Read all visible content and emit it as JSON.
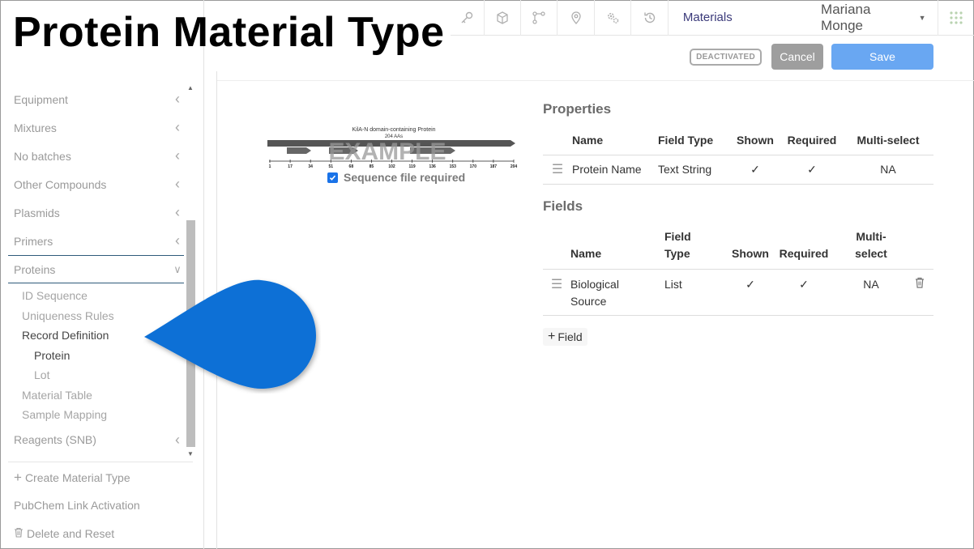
{
  "overlay": {
    "title": "Protein Material Type"
  },
  "nav": {
    "icons": [
      "key-icon",
      "cube-icon",
      "workflow-icon",
      "location-pin-icon",
      "settings-gears-icon",
      "history-icon"
    ],
    "materials_label": "Materials",
    "user_name": "Mariana Monge"
  },
  "actions": {
    "status_badge": "DEACTIVATED",
    "cancel_label": "Cancel",
    "save_label": "Save"
  },
  "sidebar": {
    "items": [
      {
        "label": "Equipment"
      },
      {
        "label": "Mixtures"
      },
      {
        "label": "No batches"
      },
      {
        "label": "Other Compounds"
      },
      {
        "label": "Plasmids"
      },
      {
        "label": "Primers"
      }
    ],
    "open_item": {
      "label": "Proteins",
      "children": [
        {
          "label": "ID Sequence"
        },
        {
          "label": "Uniqueness Rules"
        },
        {
          "label": "Record Definition"
        },
        {
          "label": "Protein"
        },
        {
          "label": "Lot"
        },
        {
          "label": "Material Table"
        },
        {
          "label": "Sample Mapping"
        }
      ]
    },
    "after_item": {
      "label": "Reagents (SNB)"
    },
    "create_label": "Create Material Type",
    "pubchem_label": "PubChem Link Activation",
    "delete_label": "Delete and Reset"
  },
  "protein_image": {
    "title": "KilA-N domain-containing Protein",
    "length_label": "204 AAs",
    "watermark": "EXAMPLE",
    "ticks": [
      "1",
      "17",
      "34",
      "51",
      "68",
      "85",
      "102",
      "119",
      "136",
      "153",
      "170",
      "187",
      "204"
    ],
    "checkbox_label": "Sequence file required",
    "checkbox_checked": true
  },
  "properties": {
    "heading": "Properties",
    "columns": [
      "Name",
      "Field Type",
      "Shown",
      "Required",
      "Multi-select"
    ],
    "rows": [
      {
        "name": "Protein Name",
        "field_type": "Text String",
        "shown": "✓",
        "required": "✓",
        "multi_select": "NA"
      }
    ]
  },
  "fields": {
    "heading": "Fields",
    "columns": {
      "name": "Name",
      "field_type_1": "Field",
      "field_type_2": "Type",
      "shown": "Shown",
      "required": "Required",
      "multi_1": "Multi-",
      "multi_2": "select"
    },
    "rows": [
      {
        "name_1": "Biological",
        "name_2": "Source",
        "field_type": "List",
        "shown": "✓",
        "required": "✓",
        "multi_select": "NA"
      }
    ],
    "add_label": "Field"
  },
  "colors": {
    "save": "#69a7f2",
    "cancel": "#9e9e9e",
    "callout": "#0a6fd6",
    "nav_text": "#3b3a7a",
    "open_border": "#2e5b7a"
  }
}
